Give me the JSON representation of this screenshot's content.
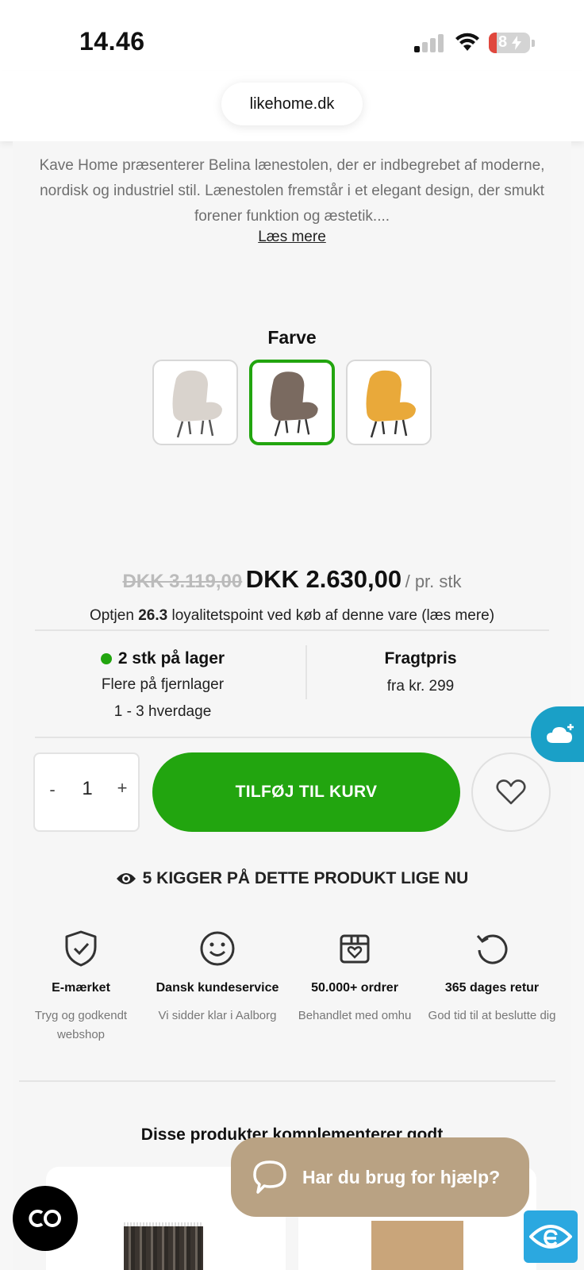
{
  "status_bar": {
    "time": "14.46",
    "battery": "8"
  },
  "browser": {
    "url": "likehome.dk"
  },
  "product": {
    "description": "Kave Home præsenterer Belina lænestolen, der er indbegrebet af moderne, nordisk og industriel stil. Lænestolen fremstår i et elegant design, der smukt forener funktion og æstetik....",
    "read_more": "Læs mere",
    "color_label": "Farve",
    "swatches": [
      {
        "name": "beige",
        "selected": false,
        "color": "#d9d3cd"
      },
      {
        "name": "brown",
        "selected": true,
        "color": "#7a6a60"
      },
      {
        "name": "yellow",
        "selected": false,
        "color": "#e9a93a"
      }
    ],
    "old_price": "DKK 3.119,00",
    "new_price": "DKK 2.630,00",
    "unit": "/ pr. stk",
    "loyalty_prefix": "Optjen ",
    "loyalty_points": "26.3",
    "loyalty_suffix": " loyalitetspoint ved køb af denne vare (læs mere)",
    "stock": {
      "main": "2 stk på lager",
      "sub": "Flere på fjernlager",
      "delivery": "1 - 3 hverdage"
    },
    "freight": {
      "title": "Fragtpris",
      "value": "fra kr. 299"
    },
    "quantity": {
      "minus": "-",
      "value": "1",
      "plus": "+"
    },
    "add_to_cart": "TILFØJ TIL KURV",
    "viewers": "5 KIGGER PÅ DETTE PRODUKT LIGE NU"
  },
  "usps": [
    {
      "icon": "shield-check-icon",
      "title": "E-mærket",
      "desc": "Tryg og godkendt webshop"
    },
    {
      "icon": "smiley-icon",
      "title": "Dansk kundeservice",
      "desc": "Vi sidder klar i Aalborg"
    },
    {
      "icon": "box-heart-icon",
      "title": "50.000+ ordrer",
      "desc": "Behandlet med omhu"
    },
    {
      "icon": "return-arrow-icon",
      "title": "365 dages retur",
      "desc": "God tid til at beslutte dig"
    }
  ],
  "related": {
    "title": "Disse produkter komplementerer godt"
  },
  "help": {
    "label": "Har du brug for hjælp?"
  },
  "colors": {
    "accent": "#22a50f",
    "help_bg": "#b9a283",
    "cloud": "#1aa0c7"
  }
}
